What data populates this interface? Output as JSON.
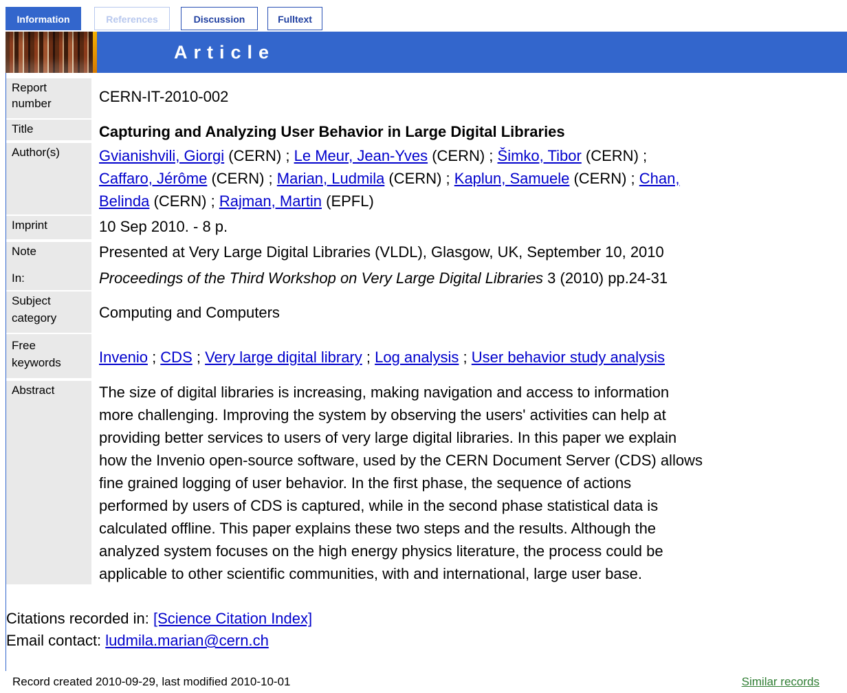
{
  "tabs": [
    {
      "label": "Information",
      "state": "active"
    },
    {
      "label": "References",
      "state": "disabled"
    },
    {
      "label": "Discussion",
      "state": "inactive"
    },
    {
      "label": "Fulltext",
      "state": "inactive"
    }
  ],
  "banner": {
    "title": "Article"
  },
  "record": {
    "report_number": {
      "label1": "Report",
      "label2": "number",
      "value": "CERN-IT-2010-002"
    },
    "title": {
      "label": "Title",
      "value": "Capturing and Analyzing User Behavior in Large Digital Libraries"
    },
    "authors": {
      "label": "Author(s)",
      "line1": {
        "a1": "Gvianishvili, Giorgi",
        "a1_aff": " (CERN) ; ",
        "a2": "Le Meur, Jean-Yves",
        "a2_aff": " (CERN) ; ",
        "a3": "Šimko, Tibor",
        "a3_aff": " (CERN) ;"
      },
      "line2": {
        "a4": "Caffaro, Jérôme",
        "a4_aff": " (CERN) ; ",
        "a5": "Marian, Ludmila",
        "a5_aff": " (CERN) ; ",
        "a6": "Kaplun, Samuele",
        "a6_aff": " (CERN) ; ",
        "a7a": "Chan,"
      },
      "line3": {
        "a7b": "Belinda",
        "a7_aff": " (CERN) ; ",
        "a8": "Rajman, Martin",
        "a8_aff": " (EPFL)"
      }
    },
    "imprint": {
      "label": "Imprint",
      "value": "10 Sep 2010. - 8 p."
    },
    "note": {
      "label": "Note",
      "value": "Presented at Very Large Digital Libraries (VLDL), Glasgow, UK, September 10, 2010"
    },
    "in": {
      "label": "In:",
      "journal": "Proceedings of the Third Workshop on Very Large Digital Libraries",
      "details": " 3 (2010) pp.24-31"
    },
    "subject": {
      "label1": "Subject",
      "label2": "category",
      "value": "Computing and Computers"
    },
    "keywords": {
      "label1": "Free",
      "label2": "keywords",
      "k1": "Invenio",
      "k2": "CDS",
      "k3": "Very large digital library",
      "k4": "Log analysis",
      "k5": "User behavior study analysis",
      "sep": " ; "
    },
    "abstract": {
      "label": "Abstract",
      "lines": [
        "The size of digital libraries is increasing, making navigation and access to information",
        "more challenging. Improving the system by observing the users' activities can help at",
        "providing better services to users of very large digital libraries. In this paper we explain",
        "how the Invenio open-source software, used by the CERN Document Server (CDS) allows",
        "fine grained logging of user behavior. In the first phase, the sequence of actions",
        "performed by users of CDS is captured, while in the second phase statistical data is",
        "calculated offline. This paper explains these two steps and the results. Although the",
        "analyzed system focuses on the high energy physics literature, the process could be",
        "applicable to other scientific communities, with and international, large user base."
      ]
    }
  },
  "footer": {
    "citations_label": "Citations recorded in: ",
    "citations_link": "[Science Citation Index]",
    "email_label": "Email contact: ",
    "email_link": "ludmila.marian@cern.ch",
    "created": "Record created 2010-09-29, last modified 2010-10-01",
    "similar": "Similar records"
  }
}
